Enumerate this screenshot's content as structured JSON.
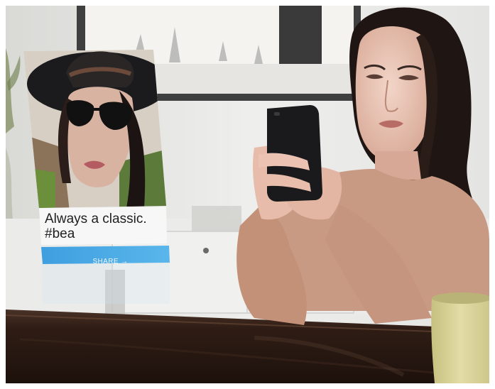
{
  "post": {
    "caption_line1": "Always a classic.",
    "caption_line2": "#bea",
    "share_label": "SHARE →"
  },
  "palette": {
    "wall": "#e7e7e5",
    "table": "#2b1a13",
    "sweater": "#c99a83",
    "share_bar": "#46a8e4",
    "mug": "#d8d29a"
  }
}
